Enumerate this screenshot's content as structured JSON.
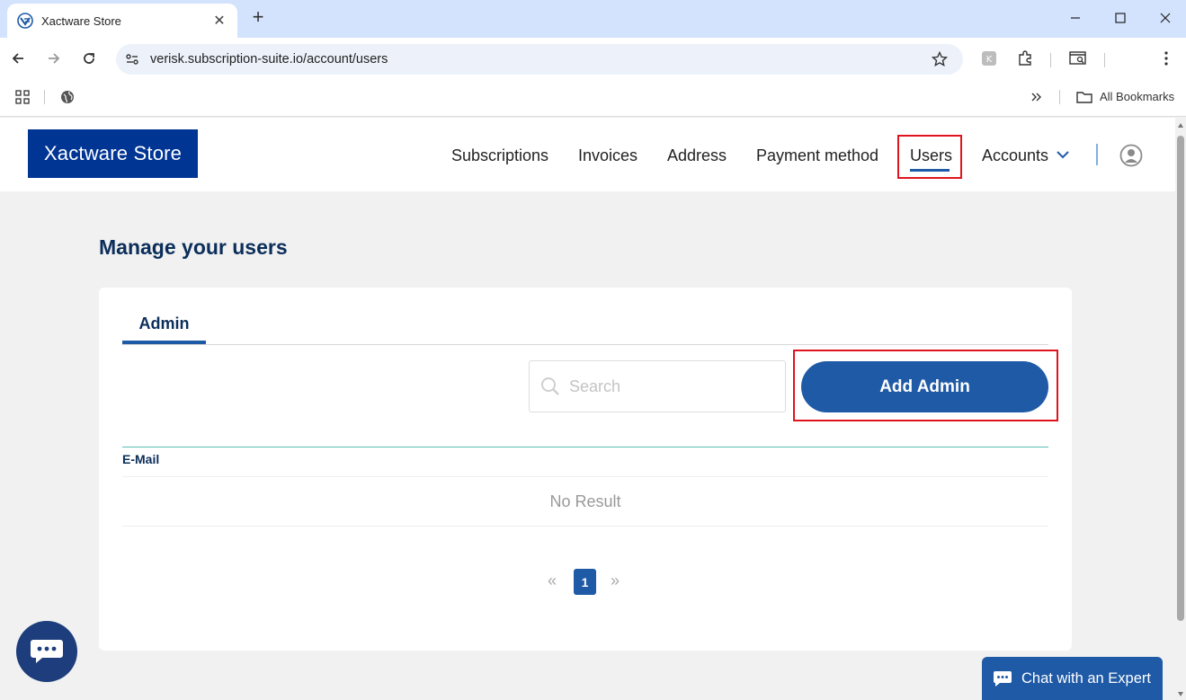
{
  "browser": {
    "tab_title": "Xactware Store",
    "url": "verisk.subscription-suite.io/account/users",
    "bookmarks_label": "All Bookmarks"
  },
  "header": {
    "logo": "Xactware Store",
    "nav": {
      "subscriptions": "Subscriptions",
      "invoices": "Invoices",
      "address": "Address",
      "payment_method": "Payment method",
      "users": "Users",
      "accounts": "Accounts"
    }
  },
  "main": {
    "title": "Manage your users",
    "tab": "Admin",
    "search_placeholder": "Search",
    "add_button": "Add Admin",
    "table": {
      "columns": [
        "E-Mail"
      ],
      "empty_text": "No Result"
    },
    "pagination": {
      "prev": "«",
      "current": "1",
      "next": "»"
    }
  },
  "chat": {
    "expert_label": "Chat with an Expert"
  },
  "colors": {
    "brand": "#003594",
    "accent": "#1f5aa6",
    "highlight": "#e0141e"
  }
}
